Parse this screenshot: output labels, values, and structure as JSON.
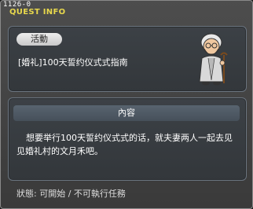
{
  "window": {
    "quest_code": "1126-0",
    "title": "QUEST INFO"
  },
  "quest": {
    "tag_label": "活動",
    "name": "[婚礼]100天誓约仪式式指南"
  },
  "content": {
    "header": "內容",
    "text": "想要举行100天誓约仪式式的话，就夫妻两人一起去见见婚礼村的文月禾吧。"
  },
  "status": {
    "text": "狀態: 可開始 / 不可執行任務"
  },
  "npc": {
    "icon": "old-man-npc-portrait"
  }
}
